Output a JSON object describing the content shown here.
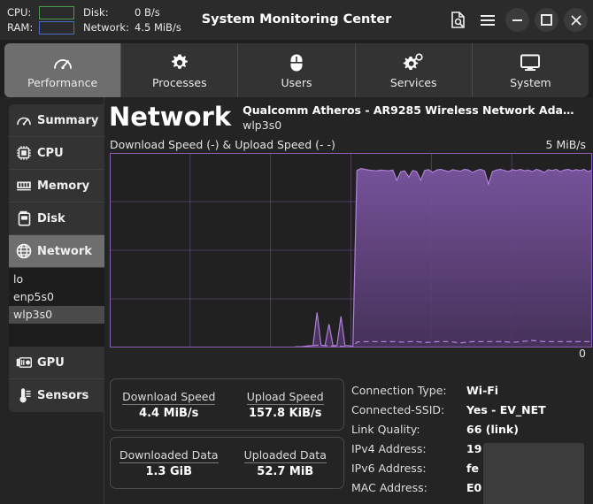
{
  "titlebar": {
    "cpu_label": "CPU:",
    "ram_label": "RAM:",
    "disk_label": "Disk:",
    "disk_value": "0 B/s",
    "network_label": "Network:",
    "network_value": "4.5 MiB/s",
    "title": "System Monitoring Center",
    "cpu_border_color": "#4c9a4c",
    "ram_border_color": "#4a6bcc",
    "icons": {
      "search": "search-document-icon",
      "menu": "hamburger-menu-icon",
      "minimize": "minimize-icon",
      "maximize": "maximize-icon",
      "close": "close-icon"
    }
  },
  "tabs": [
    {
      "label": "Performance",
      "icon": "gauge-icon",
      "active": true
    },
    {
      "label": "Processes",
      "icon": "gear-icon",
      "active": false
    },
    {
      "label": "Users",
      "icon": "mouse-icon",
      "active": false
    },
    {
      "label": "Services",
      "icon": "gears-icon",
      "active": false
    },
    {
      "label": "System",
      "icon": "monitor-icon",
      "active": false
    }
  ],
  "sidebar": {
    "items": [
      {
        "label": "Summary",
        "icon": "gauge-icon",
        "active": false
      },
      {
        "label": "CPU",
        "icon": "cpu-chip-icon",
        "active": false
      },
      {
        "label": "Memory",
        "icon": "memory-stick-icon",
        "active": false
      },
      {
        "label": "Disk",
        "icon": "hard-disk-icon",
        "active": false
      },
      {
        "label": "Network",
        "icon": "globe-icon",
        "active": true
      }
    ],
    "sub_items": [
      {
        "label": "lo",
        "active": false
      },
      {
        "label": "enp5s0",
        "active": false
      },
      {
        "label": "wlp3s0",
        "active": true
      }
    ],
    "tail_items": [
      {
        "label": "GPU",
        "icon": "gpu-card-icon",
        "active": false
      },
      {
        "label": "Sensors",
        "icon": "thermometer-icon",
        "active": false
      }
    ]
  },
  "page": {
    "title": "Network",
    "device_name": "Qualcomm Atheros - AR9285 Wireless Network Ada…",
    "interface": "wlp3s0"
  },
  "chart_data": {
    "type": "area",
    "title": "Download Speed (-) & Upload Speed (-  -)",
    "ylabel": "",
    "xlabel": "",
    "ymax_label": "5 MiB/s",
    "ymin_label": "0",
    "ylim": [
      0,
      5
    ],
    "grid": true,
    "grid_rows": 4,
    "grid_cols": 6,
    "line_color": "#b07fd8",
    "fill_color": "#6b4a8a",
    "legend": [
      {
        "name": "Download Speed",
        "style": "solid"
      },
      {
        "name": "Upload Speed",
        "style": "dashed"
      }
    ],
    "series": [
      {
        "name": "Download Speed",
        "style": "solid",
        "values": [
          0.0,
          0.0,
          0.0,
          0.0,
          0.0,
          0.0,
          0.0,
          0.0,
          0.0,
          0.0,
          0.0,
          0.0,
          0.0,
          0.0,
          0.0,
          0.0,
          0.0,
          0.0,
          0.0,
          0.0,
          0.0,
          0.0,
          0.0,
          0.0,
          0.0,
          0.0,
          0.0,
          0.0,
          0.0,
          0.0,
          0.0,
          0.0,
          0.0,
          0.0,
          0.0,
          0.0,
          0.0,
          0.0,
          0.0,
          0.0,
          0.0,
          0.0,
          0.0,
          0.0,
          0.0,
          0.0,
          0.01,
          0.02,
          0.02,
          0.03,
          0.04,
          0.05,
          0.9,
          0.06,
          0.05,
          0.6,
          0.05,
          0.05,
          0.8,
          0.05,
          0.05,
          0.02,
          4.55,
          4.6,
          4.58,
          4.56,
          4.55,
          4.54,
          4.56,
          4.55,
          4.54,
          4.56,
          4.3,
          4.52,
          4.54,
          4.38,
          4.55,
          4.52,
          4.3,
          4.55,
          4.57,
          4.5,
          4.56,
          4.58,
          4.55,
          4.52,
          4.57,
          4.55,
          4.53,
          4.58,
          4.56,
          4.5,
          4.55,
          4.58,
          4.54,
          4.2,
          4.52,
          4.56,
          4.58,
          4.55,
          4.52,
          4.57,
          4.55,
          4.58,
          4.54,
          4.56,
          4.52,
          4.58,
          4.55,
          4.5,
          4.57,
          4.55,
          4.58,
          4.52,
          4.56,
          4.58,
          4.54,
          4.57,
          4.55,
          4.58,
          4.52,
          4.56
        ]
      },
      {
        "name": "Upload Speed",
        "style": "dashed",
        "values": [
          0.0,
          0.0,
          0.0,
          0.0,
          0.0,
          0.0,
          0.0,
          0.0,
          0.0,
          0.0,
          0.0,
          0.0,
          0.0,
          0.0,
          0.0,
          0.0,
          0.0,
          0.0,
          0.0,
          0.0,
          0.0,
          0.0,
          0.0,
          0.0,
          0.0,
          0.0,
          0.0,
          0.0,
          0.0,
          0.0,
          0.0,
          0.0,
          0.0,
          0.0,
          0.0,
          0.0,
          0.0,
          0.0,
          0.0,
          0.0,
          0.0,
          0.0,
          0.0,
          0.0,
          0.0,
          0.0,
          0.0,
          0.01,
          0.02,
          0.03,
          0.04,
          0.05,
          0.06,
          0.06,
          0.05,
          0.05,
          0.04,
          0.04,
          0.03,
          0.02,
          0.01,
          0.0,
          0.14,
          0.15,
          0.15,
          0.15,
          0.15,
          0.15,
          0.15,
          0.15,
          0.15,
          0.15,
          0.15,
          0.14,
          0.14,
          0.15,
          0.15,
          0.15,
          0.14,
          0.13,
          0.13,
          0.14,
          0.15,
          0.15,
          0.15,
          0.15,
          0.14,
          0.13,
          0.12,
          0.13,
          0.14,
          0.15,
          0.15,
          0.15,
          0.15,
          0.15,
          0.15,
          0.15,
          0.15,
          0.15,
          0.14,
          0.13,
          0.14,
          0.15,
          0.16,
          0.17,
          0.18,
          0.17,
          0.16,
          0.15,
          0.15,
          0.15,
          0.15,
          0.15,
          0.15,
          0.15,
          0.15,
          0.15,
          0.15,
          0.15,
          0.15,
          0.15
        ]
      }
    ]
  },
  "stat_cards": [
    {
      "columns": [
        {
          "label": "Download Speed",
          "value": "4.4 MiB/s"
        },
        {
          "label": "Upload Speed",
          "value": "157.8 KiB/s"
        }
      ]
    },
    {
      "columns": [
        {
          "label": "Downloaded Data",
          "value": "1.3 GiB"
        },
        {
          "label": "Uploaded Data",
          "value": "52.7 MiB"
        }
      ]
    }
  ],
  "info_list": [
    {
      "key": "Connection Type:",
      "value": "Wi-Fi"
    },
    {
      "key": "Connected-SSID:",
      "value": "Yes - EV_NET"
    },
    {
      "key": "Link Quality:",
      "value": "66 (link)"
    },
    {
      "key": "IPv4 Address:",
      "value": "19"
    },
    {
      "key": "IPv6 Address:",
      "value": "fe"
    },
    {
      "key": "MAC Address:",
      "value": "E0"
    }
  ]
}
